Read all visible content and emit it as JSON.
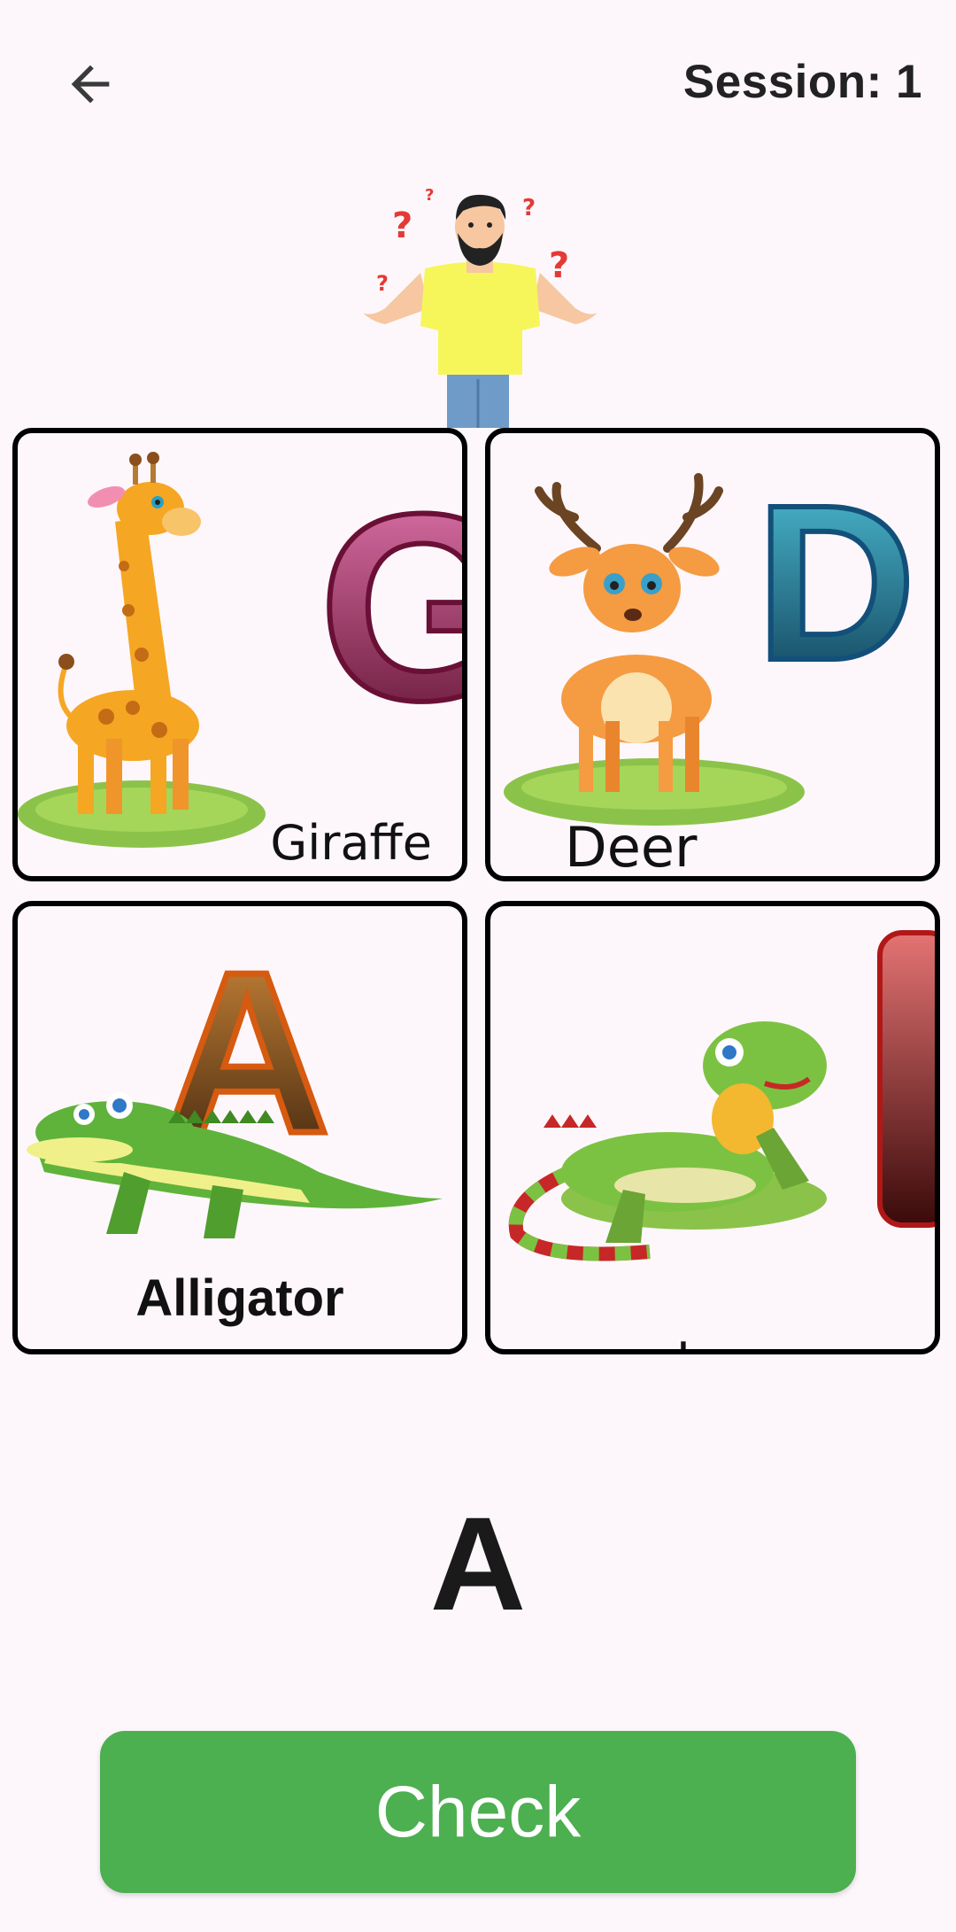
{
  "header": {
    "back_icon": "arrow-left-icon",
    "session_label": "Session: 1"
  },
  "illustration": {
    "icon": "confused-man-illustration"
  },
  "cards": [
    {
      "animal": "Giraffe",
      "letter": "G"
    },
    {
      "animal": "Deer",
      "letter": "D"
    },
    {
      "animal": "Alligator",
      "letter": "A"
    },
    {
      "animal": "Iguana",
      "letter": "I"
    }
  ],
  "prompt": {
    "target_letter": "A"
  },
  "footer": {
    "check_label": "Check"
  },
  "colors": {
    "background": "#fdf7fb",
    "check_button": "#4caf50",
    "card_border": "#000000"
  }
}
